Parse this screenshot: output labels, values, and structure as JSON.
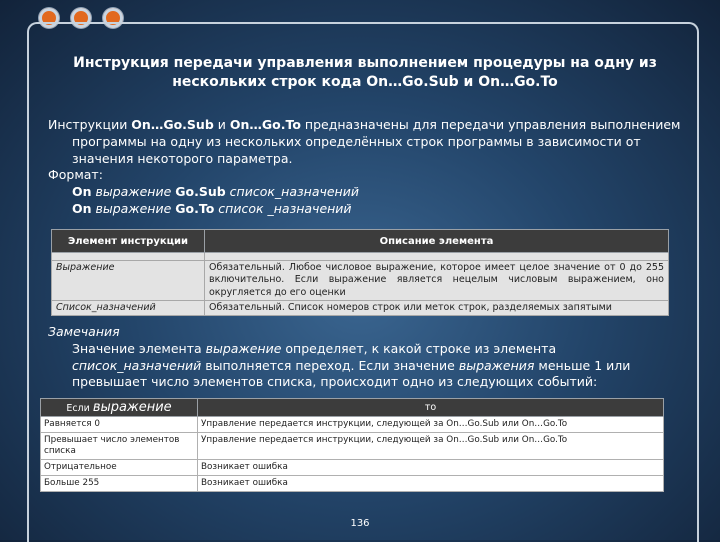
{
  "title": "Инструкция передачи управления выполнением процедуры на одну из нескольких строк кода On…Go.Sub и On…Go.To",
  "intro": {
    "p1_prefix": "Инструкции ",
    "p1_kw1": "On…Go.Sub",
    "p1_and": " и ",
    "p1_kw2": "On…Go.To",
    "p1_rest": " предназначены для передачи управления выполнением программы на одну из нескольких определённых строк программы в зависимости от значения некоторого параметра.",
    "format_label": "Формат:",
    "format1_kw1": "On",
    "format1_i1": " выражение ",
    "format1_kw2": "Go.Sub",
    "format1_i2": " список_назначений",
    "format2_kw1": "On",
    "format2_i1": " выражение ",
    "format2_kw2": "Go.To",
    "format2_i2": " список _назначений"
  },
  "table1": {
    "headers": [
      "Элемент инструкции",
      "Описание элемента"
    ],
    "rows": [
      {
        "element": "Выражение",
        "description": "Обязательный. Любое числовое выражение, которое имеет целое значение от 0 до 255 включительно. Если выражение является нецелым числовым выражением, оно округляется до его оценки"
      },
      {
        "element": "Список_назначений",
        "description": "Обязательный. Список номеров строк или меток строк, разделяемых запятыми"
      }
    ]
  },
  "notes": {
    "heading": "Замечания",
    "t1": "Значение элемента ",
    "i1": "выражение",
    "t2": " определяет, к какой строке из элемента ",
    "i2": "список_назначений",
    "t3": " выполняется переход. Если значение ",
    "i3": "выражения",
    "t4": " меньше 1 или превышает число элементов списка, происходит одно из следующих событий:"
  },
  "table2": {
    "header_if": "Если",
    "header_expr": "выражение",
    "header_then": "то",
    "rows": [
      {
        "cond": "Равняется 0",
        "result": "Управление передается инструкции, следующей за On…Go.Sub или On…Go.To"
      },
      {
        "cond": "Превышает число элементов списка",
        "result": "Управление передается инструкции, следующей за On…Go.Sub или On…Go.To"
      },
      {
        "cond": "Отрицательное",
        "result": "Возникает ошибка"
      },
      {
        "cond": "Больше 255",
        "result": "Возникает ошибка"
      }
    ]
  },
  "page_number": "136"
}
